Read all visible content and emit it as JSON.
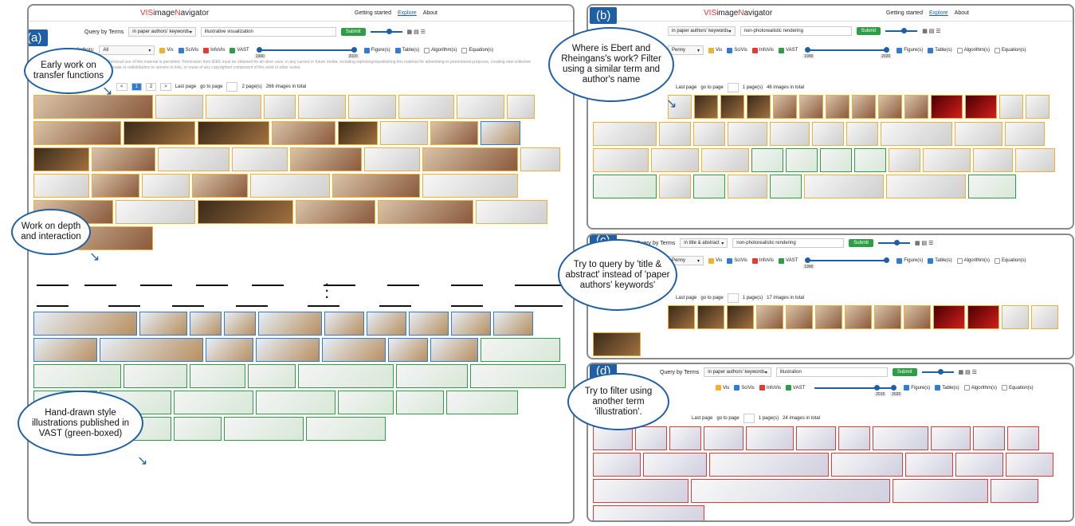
{
  "panels": {
    "a": {
      "label": "(a)",
      "app_name_prefix": "VIS",
      "app_name_mid": "image",
      "app_name_n": "N",
      "app_name_rest": "avigator",
      "nav": [
        "Getting started",
        "Explore",
        "About"
      ],
      "active_nav": "Explore",
      "query_label": "Query by Terms",
      "query_field": "in paper authors' keywords",
      "query_value": "illustrative visualization",
      "submit": "Submit",
      "authors_label": "Authors:",
      "authors_value": "All",
      "venues": [
        "Vis",
        "SciVis",
        "InfoVis",
        "VAST"
      ],
      "types": [
        "Figure(s)",
        "Table(s)",
        "Algorithm(s)",
        "Equation(s)"
      ],
      "year_from": "1990",
      "year_to": "2020",
      "notice": "© IEEE. Personal use of this material is permitted. Permission from IEEE must be obtained for all other uses, in any current or future media, including reprinting/republishing this material for advertising or promotional purposes, creating new collective works, for resale or redistribution to servers or lists, or reuse of any copyrighted component of this work in other works.",
      "pages": [
        "<",
        "1",
        "2",
        ">"
      ],
      "last_page": "Last page",
      "go_to": "go to page",
      "page_count": "2 page(s)",
      "total": "266 images in total"
    },
    "b": {
      "label": "(b)",
      "query_field": "in paper authors' keywords",
      "query_value": "non-photorealistic rendering",
      "authors_value": "Penny",
      "year_from": "1990",
      "year_to": "2020",
      "page_count": "1 page(s)",
      "total": "46 images in total"
    },
    "c": {
      "label": "(c)",
      "query_label": "Query by Terms",
      "query_field": "in title & abstract",
      "query_value": "non-photorealistic rendering",
      "authors_value": "Penny",
      "year_from": "1990",
      "page_count": "1 page(s)",
      "total": "17 images in total"
    },
    "d": {
      "label": "(d)",
      "query_label": "Query by Terms",
      "query_field": "in paper authors' keywords",
      "query_value": "illustration",
      "year_from": "2015",
      "year_to": "2020",
      "page_count": "1 page(s)",
      "total": "24 images in total"
    }
  },
  "annotations": {
    "a1": "Early work on transfer functions",
    "a2": "Work on depth and interaction",
    "a3": "Hand-drawn style illustrations published in VAST (green-boxed)",
    "b1": "Where is Ebert and Rheingans's work? Filter using a similar term and author's name",
    "c1": "Try to query by 'title & abstract' instead of 'paper authors' keywords'",
    "d1": "Try to filter using another term 'illustration'."
  },
  "colors": {
    "vis": "#f1b030",
    "scivis": "#2e7dd6",
    "infovis": "#e53935",
    "vast": "#2e9e46",
    "label_bg": "#1f5fa3"
  }
}
